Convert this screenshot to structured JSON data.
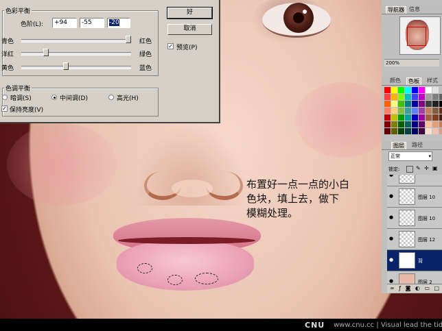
{
  "color_balance": {
    "title": "色彩平衡",
    "levels_label": "色阶(L):",
    "levels": [
      "+94",
      "-55",
      "-20"
    ],
    "sliders": [
      {
        "left": "青色",
        "right": "红色",
        "value": 94
      },
      {
        "left": "洋红",
        "right": "绿色",
        "value": -55
      },
      {
        "left": "黄色",
        "right": "蓝色",
        "value": -20
      }
    ],
    "tone_title": "色调平衡",
    "tones": [
      {
        "label": "暗调(S)",
        "selected": false
      },
      {
        "label": "中间调(D)",
        "selected": true
      },
      {
        "label": "高光(H)",
        "selected": false
      }
    ],
    "preserve_luminosity": "保持亮度(V)",
    "preserve_checked": true,
    "ok_label": "好",
    "cancel_label": "取消",
    "preview_label": "预览(P)",
    "preview_checked": true
  },
  "navigator": {
    "tabs": [
      "导航器",
      "信息"
    ],
    "zoom": "200%"
  },
  "swatches": {
    "tabs": [
      "颜色",
      "色板",
      "样式"
    ],
    "colors": [
      "#ff0000",
      "#ffff00",
      "#00ff00",
      "#00ffff",
      "#0000ff",
      "#ff00ff",
      "#ffffff",
      "#e0e0e0",
      "#c0c0c0",
      "#ff4040",
      "#ffb000",
      "#80ff00",
      "#00c0c0",
      "#4040ff",
      "#c000c0",
      "#a0a0a0",
      "#808080",
      "#606060",
      "#ff6000",
      "#ffff80",
      "#40c000",
      "#008080",
      "#0000a0",
      "#800080",
      "#404040",
      "#202020",
      "#000000",
      "#ff8060",
      "#ffd080",
      "#80c040",
      "#40a0a0",
      "#6080ff",
      "#a040a0",
      "#c08060",
      "#806040",
      "#603020",
      "#c00000",
      "#c0c000",
      "#00a000",
      "#00a0a0",
      "#0000c0",
      "#a000a0",
      "#a06040",
      "#804020",
      "#402010",
      "#800000",
      "#808000",
      "#006000",
      "#006060",
      "#000080",
      "#600060",
      "#ffc0a0",
      "#e0a080",
      "#c08060",
      "#600000",
      "#606000",
      "#004000",
      "#004040",
      "#000060",
      "#400040",
      "#ffe0d0",
      "#f0c0b0",
      "#d0a090"
    ]
  },
  "layers": {
    "tabs": [
      "图层",
      "路径"
    ],
    "blend_mode": "正常",
    "lock_label": "锁定:",
    "items": [
      {
        "name": "图层 10",
        "selected": false
      },
      {
        "name": "图层 10",
        "selected": false
      },
      {
        "name": "图层 12",
        "selected": false
      },
      {
        "name": "背",
        "selected": true
      },
      {
        "name": "图层 2",
        "selected": false
      }
    ]
  },
  "annotation": [
    "布置好一点一点的小白",
    "色块，填上去，做下",
    "模糊处理。"
  ],
  "footer": {
    "logo": "CNU",
    "text": "www.cnu.cc | Visual lead the tide"
  }
}
